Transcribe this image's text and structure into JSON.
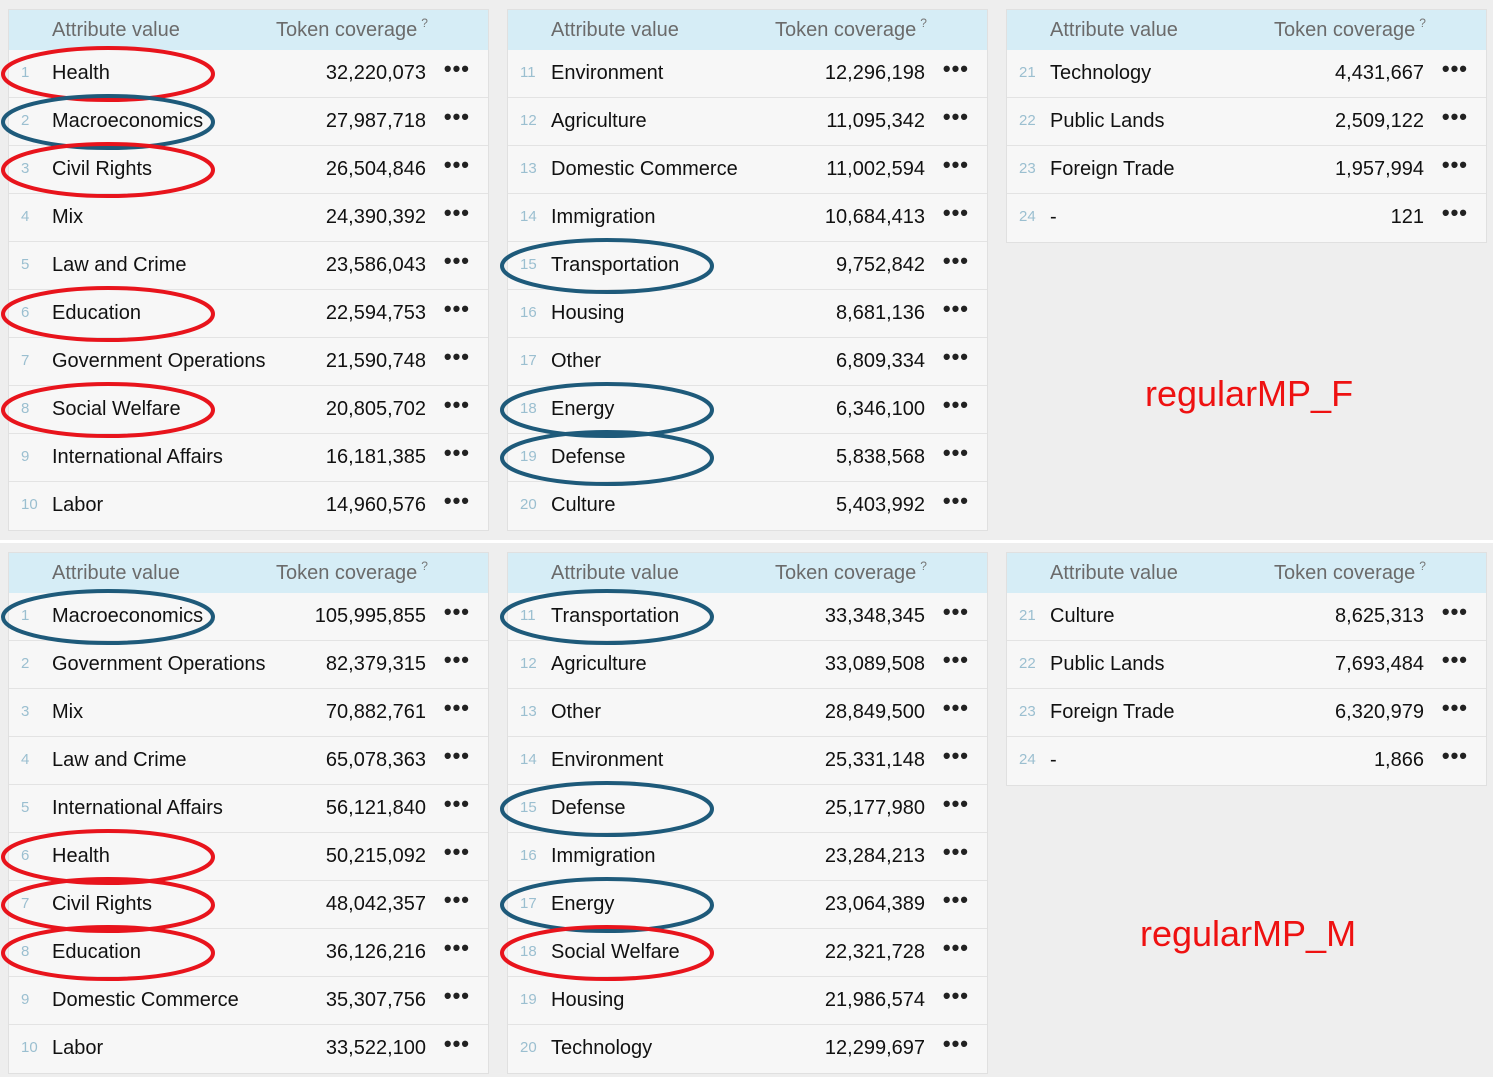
{
  "headers": {
    "attribute": "Attribute value",
    "coverage": "Token coverage",
    "help": "?"
  },
  "more_glyph": "•••",
  "colors": {
    "female_circle": "#e8141c",
    "male_circle": "#1e5a7a",
    "annotation": "#ee1111"
  },
  "panels": [
    {
      "label": "regularMP_F",
      "tables": [
        {
          "rows": [
            {
              "idx": "1",
              "name": "Health",
              "value": "32,220,073",
              "mark": "red"
            },
            {
              "idx": "2",
              "name": "Macroeconomics",
              "value": "27,987,718",
              "mark": "blue"
            },
            {
              "idx": "3",
              "name": "Civil Rights",
              "value": "26,504,846",
              "mark": "red"
            },
            {
              "idx": "4",
              "name": "Mix",
              "value": "24,390,392",
              "mark": ""
            },
            {
              "idx": "5",
              "name": "Law and Crime",
              "value": "23,586,043",
              "mark": ""
            },
            {
              "idx": "6",
              "name": "Education",
              "value": "22,594,753",
              "mark": "red"
            },
            {
              "idx": "7",
              "name": "Government Operations",
              "value": "21,590,748",
              "mark": ""
            },
            {
              "idx": "8",
              "name": "Social Welfare",
              "value": "20,805,702",
              "mark": "red"
            },
            {
              "idx": "9",
              "name": "International Affairs",
              "value": "16,181,385",
              "mark": ""
            },
            {
              "idx": "10",
              "name": "Labor",
              "value": "14,960,576",
              "mark": ""
            }
          ]
        },
        {
          "rows": [
            {
              "idx": "11",
              "name": "Environment",
              "value": "12,296,198",
              "mark": ""
            },
            {
              "idx": "12",
              "name": "Agriculture",
              "value": "11,095,342",
              "mark": ""
            },
            {
              "idx": "13",
              "name": "Domestic Commerce",
              "value": "11,002,594",
              "mark": ""
            },
            {
              "idx": "14",
              "name": "Immigration",
              "value": "10,684,413",
              "mark": ""
            },
            {
              "idx": "15",
              "name": "Transportation",
              "value": "9,752,842",
              "mark": "blue"
            },
            {
              "idx": "16",
              "name": "Housing",
              "value": "8,681,136",
              "mark": ""
            },
            {
              "idx": "17",
              "name": "Other",
              "value": "6,809,334",
              "mark": ""
            },
            {
              "idx": "18",
              "name": "Energy",
              "value": "6,346,100",
              "mark": "blue"
            },
            {
              "idx": "19",
              "name": "Defense",
              "value": "5,838,568",
              "mark": "blue"
            },
            {
              "idx": "20",
              "name": "Culture",
              "value": "5,403,992",
              "mark": ""
            }
          ]
        },
        {
          "rows": [
            {
              "idx": "21",
              "name": "Technology",
              "value": "4,431,667",
              "mark": ""
            },
            {
              "idx": "22",
              "name": "Public Lands",
              "value": "2,509,122",
              "mark": ""
            },
            {
              "idx": "23",
              "name": "Foreign Trade",
              "value": "1,957,994",
              "mark": ""
            },
            {
              "idx": "24",
              "name": "-",
              "value": "121",
              "mark": ""
            }
          ]
        }
      ]
    },
    {
      "label": "regularMP_M",
      "tables": [
        {
          "rows": [
            {
              "idx": "1",
              "name": "Macroeconomics",
              "value": "105,995,855",
              "mark": "blue"
            },
            {
              "idx": "2",
              "name": "Government Operations",
              "value": "82,379,315",
              "mark": ""
            },
            {
              "idx": "3",
              "name": "Mix",
              "value": "70,882,761",
              "mark": ""
            },
            {
              "idx": "4",
              "name": "Law and Crime",
              "value": "65,078,363",
              "mark": ""
            },
            {
              "idx": "5",
              "name": "International Affairs",
              "value": "56,121,840",
              "mark": ""
            },
            {
              "idx": "6",
              "name": "Health",
              "value": "50,215,092",
              "mark": "red"
            },
            {
              "idx": "7",
              "name": "Civil Rights",
              "value": "48,042,357",
              "mark": "red"
            },
            {
              "idx": "8",
              "name": "Education",
              "value": "36,126,216",
              "mark": "red"
            },
            {
              "idx": "9",
              "name": "Domestic Commerce",
              "value": "35,307,756",
              "mark": ""
            },
            {
              "idx": "10",
              "name": "Labor",
              "value": "33,522,100",
              "mark": ""
            }
          ]
        },
        {
          "rows": [
            {
              "idx": "11",
              "name": "Transportation",
              "value": "33,348,345",
              "mark": "blue"
            },
            {
              "idx": "12",
              "name": "Agriculture",
              "value": "33,089,508",
              "mark": ""
            },
            {
              "idx": "13",
              "name": "Other",
              "value": "28,849,500",
              "mark": ""
            },
            {
              "idx": "14",
              "name": "Environment",
              "value": "25,331,148",
              "mark": ""
            },
            {
              "idx": "15",
              "name": "Defense",
              "value": "25,177,980",
              "mark": "blue"
            },
            {
              "idx": "16",
              "name": "Immigration",
              "value": "23,284,213",
              "mark": ""
            },
            {
              "idx": "17",
              "name": "Energy",
              "value": "23,064,389",
              "mark": "blue"
            },
            {
              "idx": "18",
              "name": "Social Welfare",
              "value": "22,321,728",
              "mark": "red"
            },
            {
              "idx": "19",
              "name": "Housing",
              "value": "21,986,574",
              "mark": ""
            },
            {
              "idx": "20",
              "name": "Technology",
              "value": "12,299,697",
              "mark": ""
            }
          ]
        },
        {
          "rows": [
            {
              "idx": "21",
              "name": "Culture",
              "value": "8,625,313",
              "mark": ""
            },
            {
              "idx": "22",
              "name": "Public Lands",
              "value": "7,693,484",
              "mark": ""
            },
            {
              "idx": "23",
              "name": "Foreign Trade",
              "value": "6,320,979",
              "mark": ""
            },
            {
              "idx": "24",
              "name": "-",
              "value": "1,866",
              "mark": ""
            }
          ]
        }
      ]
    }
  ]
}
